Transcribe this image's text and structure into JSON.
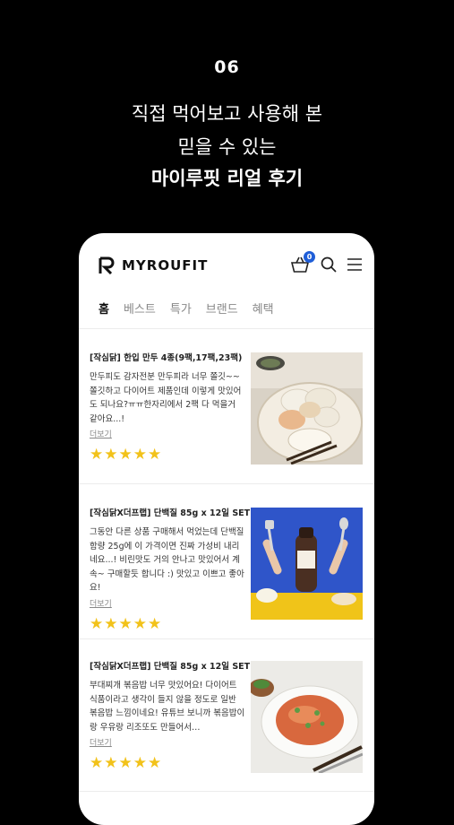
{
  "hero": {
    "step": "06",
    "line1": "직접 먹어보고 사용해 본",
    "line2": "믿을 수 있는",
    "line3": "마이루핏 리얼 후기"
  },
  "app": {
    "brand": "MYROUFIT",
    "cart_count": "0",
    "tabs": [
      "홈",
      "베스트",
      "특가",
      "브랜드",
      "혜택"
    ]
  },
  "reviews": [
    {
      "title": "[작심닭] 한입 만두 4종(9팩,17팩,23팩)",
      "body": "만두피도 감자전분 만두피라 너무 쫄깃~~ 쫄깃하고 다이어트 제품인데 이렇게 맛있어도 되나요?ㅠㅠ한자리에서 2팩 다 먹을거 같아요...!",
      "more": "더보기",
      "rating": 5
    },
    {
      "title": "[작심닭X더프랩] 단백질 85g x 12일 SET",
      "body": "그동안 다른 상품 구매해서 먹었는데 단백질 함량 25g에 이 가격이면 진짜 가성비 내리네요...! 비린맛도 거의 안나고 맛있어서 계속~ 구매할듯 합니다 :) 맛있고 이쁘고 좋아요!",
      "more": "더보기",
      "rating": 5
    },
    {
      "title": "[작심닭X더프랩] 단백질 85g x 12일 SET",
      "body": "부대찌개 볶음밥 너무 맛있어요! 다이어트 식품이라고 생각이 들지 않을 정도로 일반 볶음밥 느낌이네요! 유튜브 보니까 볶음밥이랑 우유랑 리조또도 만들어서…",
      "more": "더보기",
      "rating": 5
    }
  ],
  "colors": {
    "background": "#000000",
    "star": "#f2c21a",
    "badge": "#1f5ed8"
  }
}
